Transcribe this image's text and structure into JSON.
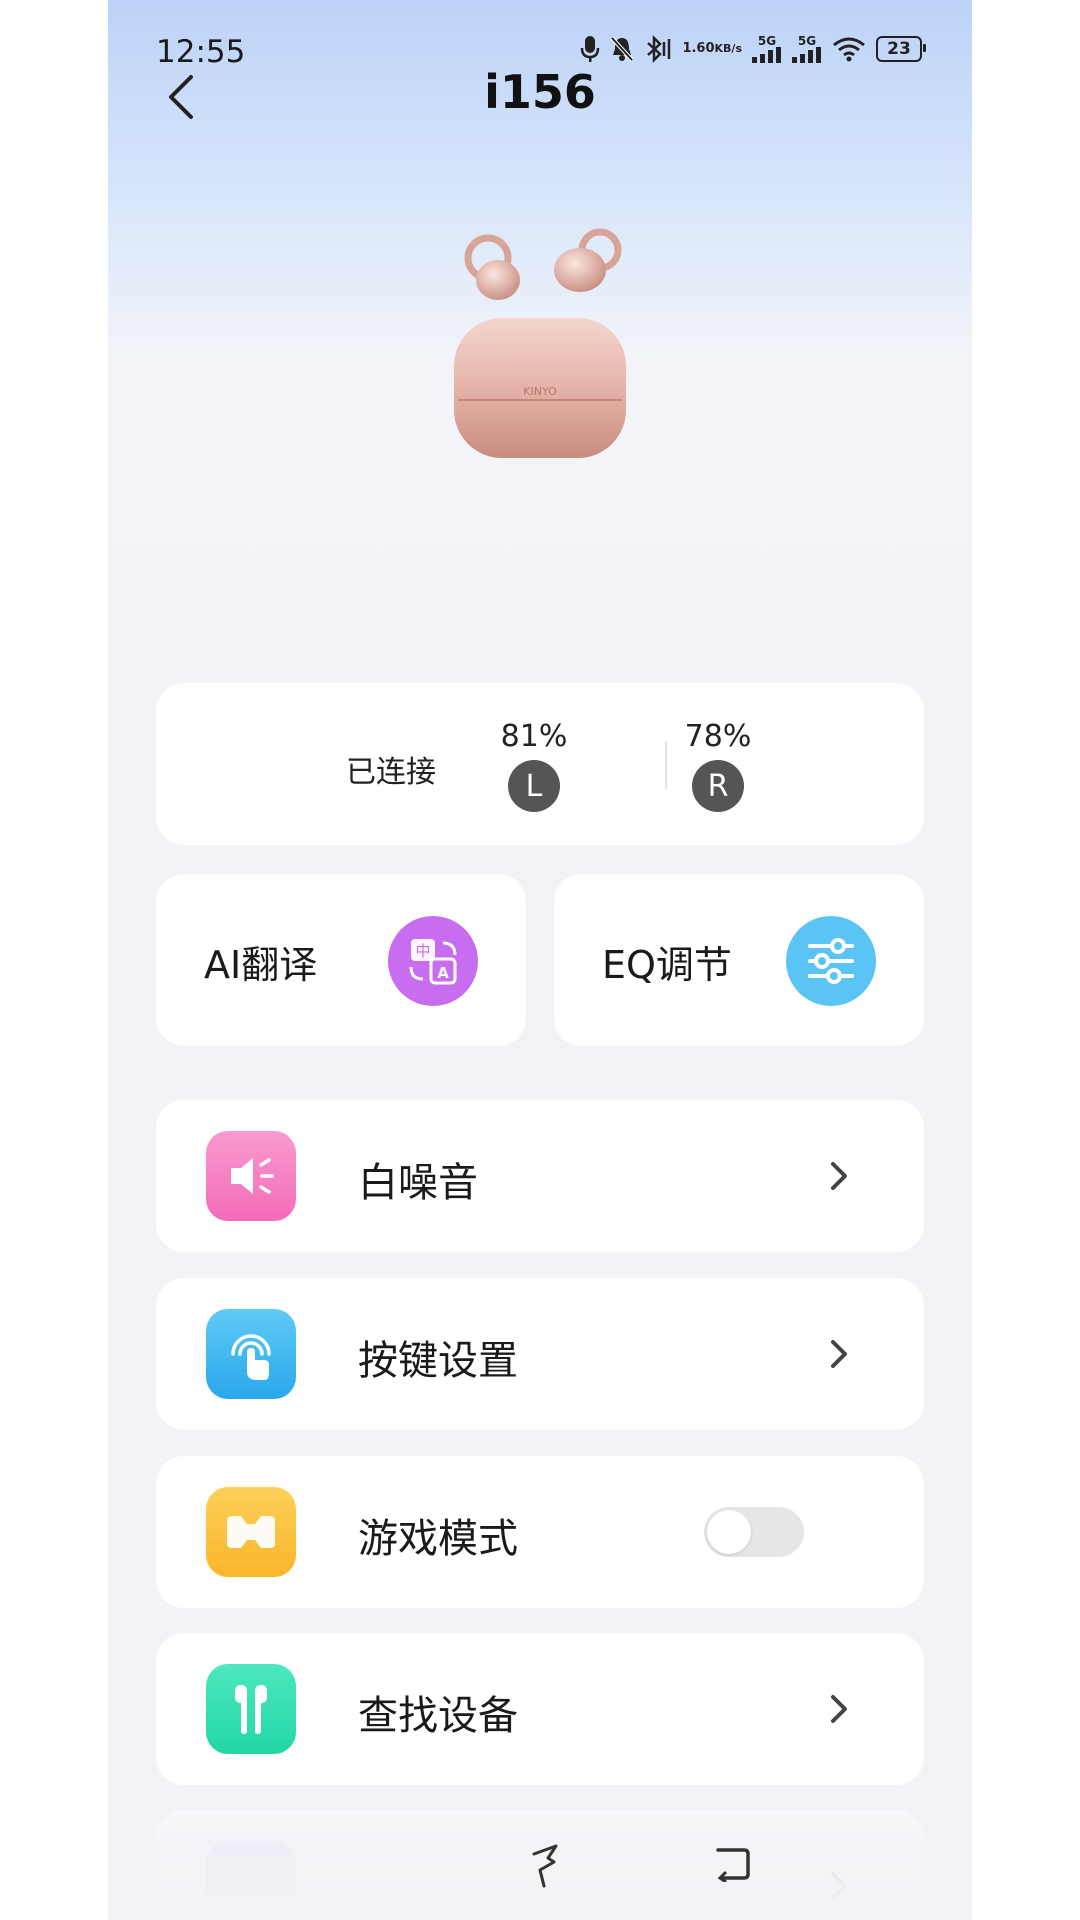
{
  "status_bar": {
    "time": "12:55",
    "net_speed_value": "1.60",
    "net_speed_unit": "KB/s",
    "signal1_label": "5G",
    "signal2_label": "5G",
    "battery": "23"
  },
  "header": {
    "title": "i156"
  },
  "product": {
    "brand": "KINYO"
  },
  "connection": {
    "status": "已连接",
    "left_battery": "81%",
    "left_label": "L",
    "right_battery": "78%",
    "right_label": "R"
  },
  "features": [
    {
      "label": "AI翻译",
      "icon": "translate-icon",
      "color": "#c96df0"
    },
    {
      "label": "EQ调节",
      "icon": "equalizer-icon",
      "color": "#5ac4f4"
    }
  ],
  "menu": [
    {
      "label": "白噪音",
      "icon": "speaker-icon",
      "color": "#f57bbf",
      "control": "chevron"
    },
    {
      "label": "按键设置",
      "icon": "touch-icon",
      "color": "#42b8f2",
      "control": "chevron"
    },
    {
      "label": "游戏模式",
      "icon": "gamepad-icon",
      "color": "#fbc23e",
      "control": "toggle",
      "toggle_on": false
    },
    {
      "label": "查找设备",
      "icon": "earbuds-icon",
      "color": "#2fdfae",
      "control": "chevron"
    }
  ]
}
